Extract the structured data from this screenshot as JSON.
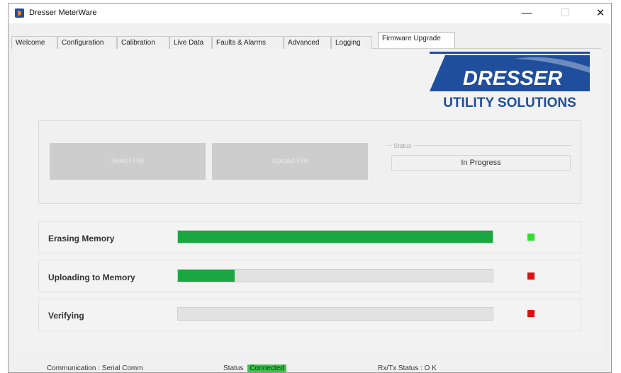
{
  "window": {
    "title": "Dresser MeterWare",
    "controls": {
      "minimize": "—",
      "maximize": "☐",
      "close": "✕"
    }
  },
  "tabs": [
    {
      "label": "Welcome",
      "active": false
    },
    {
      "label": "Configuration",
      "active": false
    },
    {
      "label": "Calibration",
      "active": false
    },
    {
      "label": "Live Data",
      "active": false
    },
    {
      "label": "Faults & Alarms",
      "active": false
    },
    {
      "label": "Advanced",
      "active": false
    },
    {
      "label": "Logging",
      "active": false
    },
    {
      "label": "Firmware Upgrade",
      "active": true
    }
  ],
  "logo": {
    "line1": "DRESSER",
    "line2": "UTILITY SOLUTIONS",
    "brand_color": "#1f4e9c"
  },
  "actions": {
    "select_file_label": "Select File",
    "upload_file_label": "Upload File"
  },
  "status": {
    "legend": "Status",
    "value": "In Progress"
  },
  "progress": [
    {
      "label": "Erasing Memory",
      "fraction": 1.0,
      "state_color": "#33dd33"
    },
    {
      "label": "Uploading to Memory",
      "fraction": 0.18,
      "state_color": "#dd1111"
    },
    {
      "label": "Verifying",
      "fraction": 0.0,
      "state_color": "#dd1111"
    }
  ],
  "statusbar": {
    "communication": "Communication : Serial Comm",
    "status_label": "Status",
    "status_value": "Connected",
    "rxtx": "Rx/Tx Status : O K"
  }
}
